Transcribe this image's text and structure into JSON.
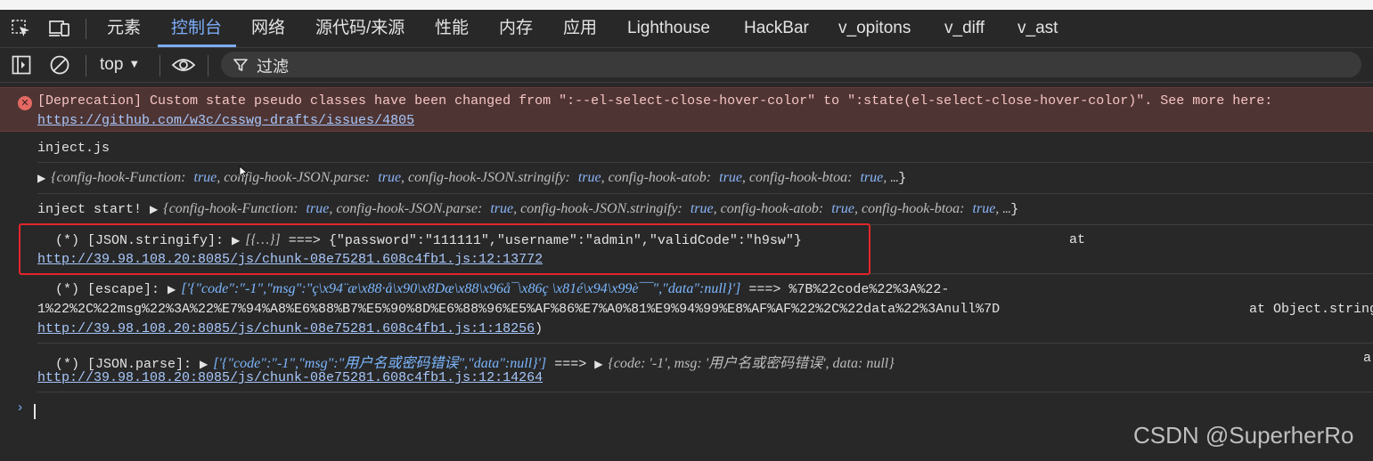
{
  "tabs": [
    {
      "label": "元素",
      "active": false
    },
    {
      "label": "控制台",
      "active": true
    },
    {
      "label": "网络",
      "active": false
    },
    {
      "label": "源代码/来源",
      "active": false
    },
    {
      "label": "性能",
      "active": false
    },
    {
      "label": "内存",
      "active": false
    },
    {
      "label": "应用",
      "active": false
    },
    {
      "label": "Lighthouse",
      "active": false
    },
    {
      "label": "HackBar",
      "active": false
    },
    {
      "label": "v_opitons",
      "active": false
    },
    {
      "label": "v_diff",
      "active": false
    },
    {
      "label": "v_ast",
      "active": false
    }
  ],
  "toolbar": {
    "context": "top",
    "filter_placeholder": "过滤"
  },
  "console": {
    "error": {
      "text": "[Deprecation] Custom state pseudo classes have been changed from \":--el-select-close-hover-color\" to \":state(el-select-close-hover-color)\". See more here:",
      "link": "https://github.com/w3c/csswg-drafts/issues/4805"
    },
    "inject_file": "inject.js",
    "config_obj": {
      "k1": "config-hook-Function:",
      "k2": "config-hook-JSON.parse:",
      "k3": "config-hook-JSON.stringify:",
      "k4": "config-hook-atob:",
      "k5": "config-hook-btoa:",
      "v": "true",
      "open": "{",
      "close": "…}"
    },
    "inject_start": "inject start!",
    "stringify": {
      "prefix": "(*) [JSON.stringify]:",
      "arg": "[{…}]",
      "arrow": "===>",
      "result": "{\"password\":\"111111\",\"username\":\"admin\",\"validCode\":\"h9sw\"}",
      "at": "at",
      "link": "http://39.98.108.20:8085/js/chunk-08e75281.608c4fb1.js:12:13772"
    },
    "escape": {
      "prefix": "(*) [escape]:",
      "arg": "['{\"code\":\"-1\",\"msg\":\"ç\\x94¨æ\\x88·å\\x90\\x8Dæ\\x88\\x96å¯\\x86ç  \\x81é\\x94\\x99è¯¯\",\"data\":null}']",
      "arrow": "===>",
      "result1": "%7B%22code%22%3A%22-",
      "result2": "1%22%2C%22msg%22%3A%22%E7%94%A8%E6%88%B7%E5%90%8D%E6%88%96%E5%AF%86%E7%A0%81%E9%94%99%E8%AF%AF%22%2C%22data%22%3Anull%7D",
      "at": "at Object.string",
      "link": "http://39.98.108.20:8085/js/chunk-08e75281.608c4fb1.js:1:18256",
      "close": ")"
    },
    "parse": {
      "prefix": "(*) [JSON.parse]:",
      "arg": "['{\"code\":\"-1\",\"msg\":\"用户名或密码错误\",\"data\":null}']",
      "arrow": "===>",
      "result": "{code: '-1', msg: '用户名或密码错误', data: null}",
      "at": "a",
      "link": "http://39.98.108.20:8085/js/chunk-08e75281.608c4fb1.js:12:14264"
    },
    "prompt": "›"
  },
  "watermark": "CSDN @SuperherRo",
  "colors": {
    "background": "#282828",
    "accent": "#7cacf8",
    "error_bg": "#4e3534",
    "highlight_box": "#e3262c"
  }
}
